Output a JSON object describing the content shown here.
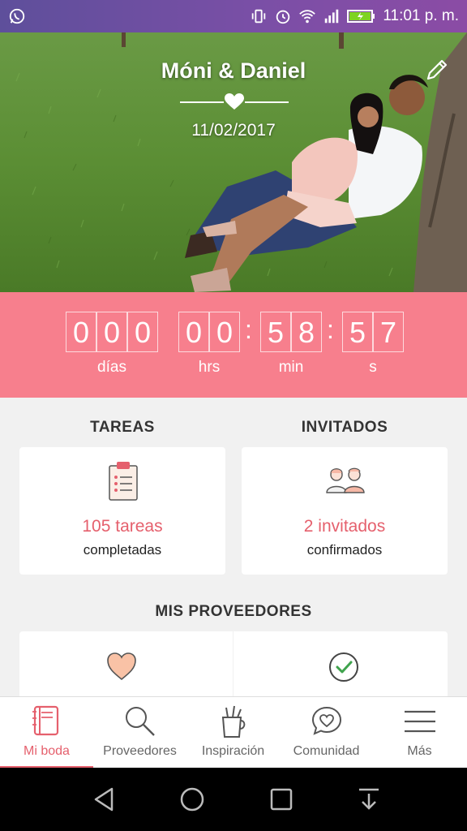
{
  "status_bar": {
    "time": "11:01 p. m.",
    "icons": [
      "whatsapp-icon",
      "vibrate-icon",
      "alarm-icon",
      "wifi-icon",
      "signal-icon",
      "battery-icon"
    ]
  },
  "hero": {
    "couple": "Móni & Daniel",
    "date": "11/02/2017"
  },
  "countdown": {
    "days": [
      "0",
      "0",
      "0"
    ],
    "hours": [
      "0",
      "0"
    ],
    "minutes": [
      "5",
      "8"
    ],
    "seconds": [
      "5",
      "7"
    ],
    "labels": {
      "days": "días",
      "hours": "hrs",
      "minutes": "min",
      "seconds": "s"
    }
  },
  "tasks": {
    "title": "TAREAS",
    "value": "105 tareas",
    "sub": "completadas"
  },
  "guests": {
    "title": "INVITADOS",
    "value": "2 invitados",
    "sub": "confirmados"
  },
  "vendors": {
    "title": "MIS PROVEEDORES"
  },
  "bottom_nav": {
    "items": [
      {
        "label": "Mi boda",
        "icon": "notebook-icon",
        "active": true
      },
      {
        "label": "Proveedores",
        "icon": "search-icon"
      },
      {
        "label": "Inspiración",
        "icon": "pencil-cup-icon"
      },
      {
        "label": "Comunidad",
        "icon": "chat-heart-icon"
      },
      {
        "label": "Más",
        "icon": "menu-icon"
      }
    ]
  },
  "colors": {
    "accent": "#e5606d",
    "countdown_bg": "#f77f8d",
    "status_bar": "#7a4fa6"
  }
}
